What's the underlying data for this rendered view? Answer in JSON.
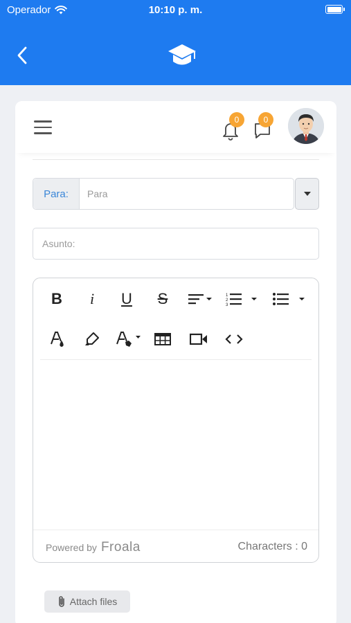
{
  "status": {
    "carrier": "Operador",
    "time": "10:10 p. m."
  },
  "header": {
    "notifications_count": "0",
    "messages_count": "0"
  },
  "form": {
    "to_label": "Para:",
    "to_placeholder": "Para",
    "subject_placeholder": "Asunto:"
  },
  "editor": {
    "toolbar_row1": [
      "bold-icon",
      "italic-icon",
      "underline-icon",
      "strikethrough-icon",
      "align-icon",
      "ordered-list-icon",
      "unordered-list-icon"
    ],
    "toolbar_row2": [
      "text-color-icon",
      "highlight-icon",
      "paragraph-style-icon",
      "table-icon",
      "video-icon",
      "code-view-icon"
    ],
    "bold": "B",
    "italic": "i",
    "underline": "U",
    "strike": "S",
    "powered_by": "Powered by",
    "brand": "Froala",
    "characters": "Characters : 0"
  },
  "attach": {
    "label": "Attach files"
  },
  "colors": {
    "primary": "#1e7bf0",
    "badge": "#f7a534",
    "link": "#3a86d8"
  }
}
